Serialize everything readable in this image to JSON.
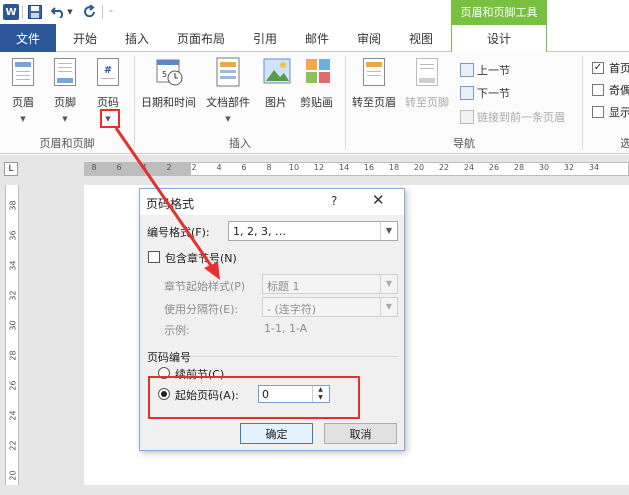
{
  "qa": {
    "logo": "W",
    "custom_menu": "⁼"
  },
  "context_title": "页眉和页脚工具",
  "tabs": {
    "file": "文件",
    "home": "开始",
    "insert": "插入",
    "page_layout": "页面布局",
    "references": "引用",
    "mailings": "邮件",
    "review": "审阅",
    "view": "视图",
    "design": "设计"
  },
  "ribbon": {
    "header": "页眉",
    "footer": "页脚",
    "page_number": "页码",
    "group1": "页眉和页脚",
    "datetime": "日期和时间",
    "doc_parts": "文档部件",
    "picture": "图片",
    "clipart": "剪贴画",
    "group2": "插入",
    "goto_header": "转至页眉",
    "goto_footer": "转至页脚",
    "prev": "上一节",
    "next": "下一节",
    "link_prev": "链接到前一条页眉",
    "group3": "导航",
    "opt1": "首页",
    "opt2": "奇偶",
    "opt3": "显示",
    "group4": "选"
  },
  "ruler": {
    "hticks": [
      "8",
      "6",
      "4",
      "2",
      "2",
      "4",
      "6",
      "8",
      "10",
      "12",
      "14",
      "16",
      "18",
      "20",
      "22",
      "24",
      "26",
      "28",
      "30",
      "32",
      "34"
    ],
    "vticks": [
      "38",
      "36",
      "34",
      "32",
      "30",
      "28",
      "26",
      "24",
      "22",
      "20"
    ]
  },
  "dialog": {
    "title": "页码格式",
    "help": "?",
    "close": "✕",
    "number_format_label": "编号格式(F):",
    "number_format_value": "1, 2, 3, …",
    "include_chapter": "包含章节号(N)",
    "chapter_style_label": "章节起始样式(P)",
    "chapter_style_value": "标题 1",
    "separator_label": "使用分隔符(E):",
    "separator_value": "-  (连字符)",
    "example_label": "示例:",
    "example_value": "1-1, 1-A",
    "numbering_group": "页码编号",
    "continue_label": "续前节(C)",
    "start_at_label": "起始页码(A):",
    "start_at_value": "0",
    "ok": "确定",
    "cancel": "取消"
  },
  "colors": {
    "brand": "#2b579a",
    "context": "#78c040",
    "annotation": "#e53030"
  }
}
